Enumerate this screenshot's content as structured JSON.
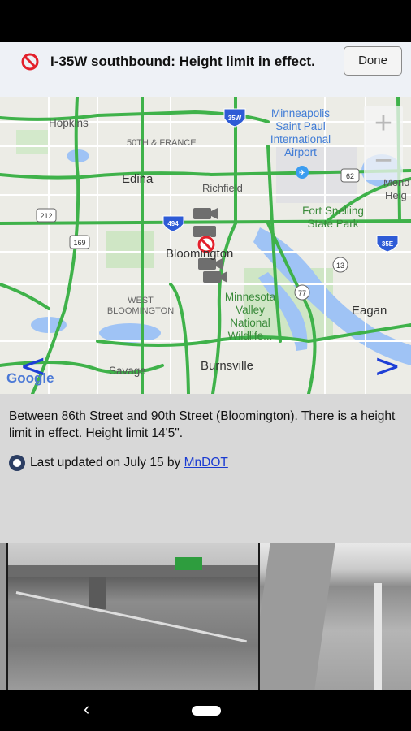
{
  "alert": {
    "title": "I-35W southbound: Height limit in effect.",
    "done_label": "Done"
  },
  "map": {
    "labels": {
      "minneapolis": "Minneapolis Saint Paul International Airport",
      "hopkins": "Hopkins",
      "france": "50TH & FRANCE",
      "edina": "Edina",
      "richfield": "Richfield",
      "fort_snelling": "Fort Snelling State Park",
      "bloomington": "Bloomington",
      "west_bloomington": "WEST BLOOMINGTON",
      "mn_valley": "Minnesota Valley National Wildlife...",
      "eagan": "Eagan",
      "savage": "Savage",
      "burnsville": "Burnsville",
      "mend": "Mend",
      "heig": "Heig",
      "google": "Google"
    },
    "shields": [
      "35W",
      "494",
      "212",
      "169",
      "62",
      "13",
      "77",
      "35E"
    ],
    "zoom_in": "+",
    "zoom_out": "−",
    "prev": "<",
    "next": ">"
  },
  "detail": {
    "description": "Between 86th Street and 90th Street (Bloomington). There is a height limit in effect. Height limit 14'5\".",
    "updated_prefix": "Last updated on July 15 by",
    "source": "MnDOT"
  },
  "nav": {
    "back": "‹"
  },
  "colors": {
    "header_bg": "#eef1f6",
    "road_green": "#3fb24a",
    "water": "#9fc3f5",
    "info_bg": "#d8d8d8",
    "link": "#1a3bd1",
    "alert_red": "#e3202b"
  }
}
